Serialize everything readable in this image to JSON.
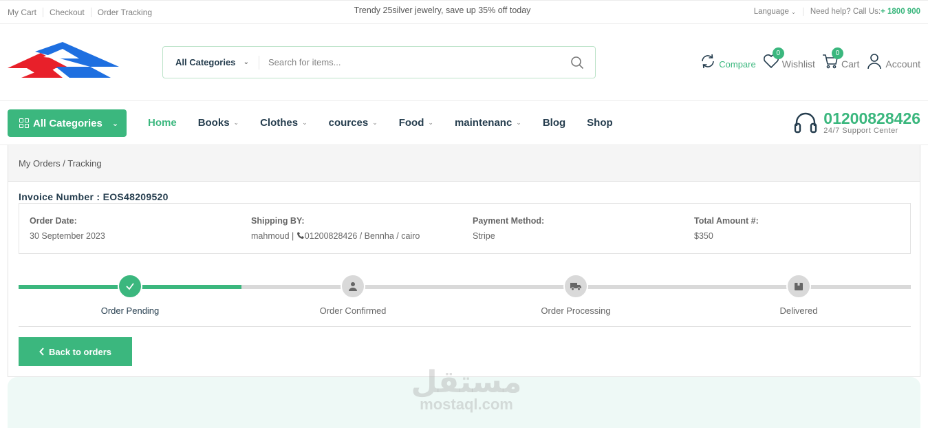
{
  "topbar": {
    "links": [
      "My Cart",
      "Checkout",
      "Order Tracking"
    ],
    "promo": "Trendy 25silver jewelry, save up 35% off today",
    "language": "Language",
    "help_text": "Need help? Call Us:",
    "help_phone": "+ 1800 900"
  },
  "header": {
    "search": {
      "category": "All Categories",
      "placeholder": "Search for items..."
    },
    "actions": {
      "compare": "Compare",
      "wishlist": "Wishlist",
      "wishlist_count": "0",
      "cart": "Cart",
      "cart_count": "0",
      "account": "Account"
    }
  },
  "nav": {
    "all_categories": "All Categories",
    "items": [
      "Home",
      "Books",
      "Clothes",
      "cources",
      "Food",
      "maintenanc",
      "Blog",
      "Shop"
    ],
    "support_number": "01200828426",
    "support_sub": "24/7 Support Center"
  },
  "tracking": {
    "breadcrumb": "My Orders / Tracking",
    "invoice": "Invoice Number : EOS48209520",
    "info": {
      "order_date_label": "Order Date:",
      "order_date": "30 September 2023",
      "shipping_label": "Shipping BY:",
      "shipping_name": "mahmoud |",
      "shipping_phone": "01200828426 / Bennha / cairo",
      "payment_label": "Payment Method:",
      "payment": "Stripe",
      "total_label": "Total Amount #:",
      "total": "$350"
    },
    "steps": [
      "Order Pending",
      "Order Confirmed",
      "Order Processing",
      "Delivered"
    ],
    "back_button": "Back to orders"
  },
  "watermark": {
    "arabic": "مستقل",
    "latin": "mostaql.com"
  },
  "colors": {
    "accent": "#3bb77e",
    "heading": "#253d4e",
    "logo_blue": "#1e6fe0",
    "logo_red": "#e8202a"
  }
}
